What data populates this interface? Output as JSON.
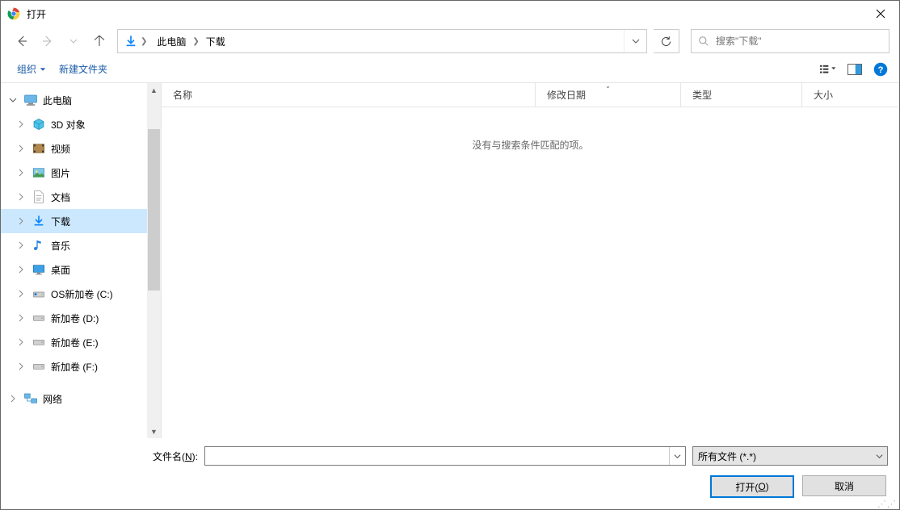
{
  "window": {
    "title": "打开"
  },
  "nav": {
    "breadcrumbs": [
      "此电脑",
      "下载"
    ],
    "search_placeholder": "搜索\"下载\""
  },
  "toolbar": {
    "organize": "组织",
    "new_folder": "新建文件夹"
  },
  "tree": {
    "root": {
      "label": "此电脑"
    },
    "items": [
      {
        "label": "3D 对象",
        "icon": "cube"
      },
      {
        "label": "视频",
        "icon": "film"
      },
      {
        "label": "图片",
        "icon": "picture"
      },
      {
        "label": "文档",
        "icon": "doc"
      },
      {
        "label": "下载",
        "icon": "download",
        "selected": true
      },
      {
        "label": "音乐",
        "icon": "music"
      },
      {
        "label": "桌面",
        "icon": "desktop"
      },
      {
        "label": "OS新加卷 (C:)",
        "icon": "drive-os"
      },
      {
        "label": "新加卷 (D:)",
        "icon": "drive"
      },
      {
        "label": "新加卷 (E:)",
        "icon": "drive"
      },
      {
        "label": "新加卷 (F:)",
        "icon": "drive"
      }
    ],
    "network": {
      "label": "网络"
    }
  },
  "columns": {
    "name": "名称",
    "date": "修改日期",
    "type": "类型",
    "size": "大小"
  },
  "list": {
    "empty": "没有与搜索条件匹配的项。"
  },
  "footer": {
    "filename_label_pre": "文件名(",
    "filename_label_u": "N",
    "filename_label_post": "):",
    "filetype": "所有文件 (*.*)",
    "open_pre": "打开(",
    "open_u": "O",
    "open_post": ")",
    "cancel": "取消"
  }
}
